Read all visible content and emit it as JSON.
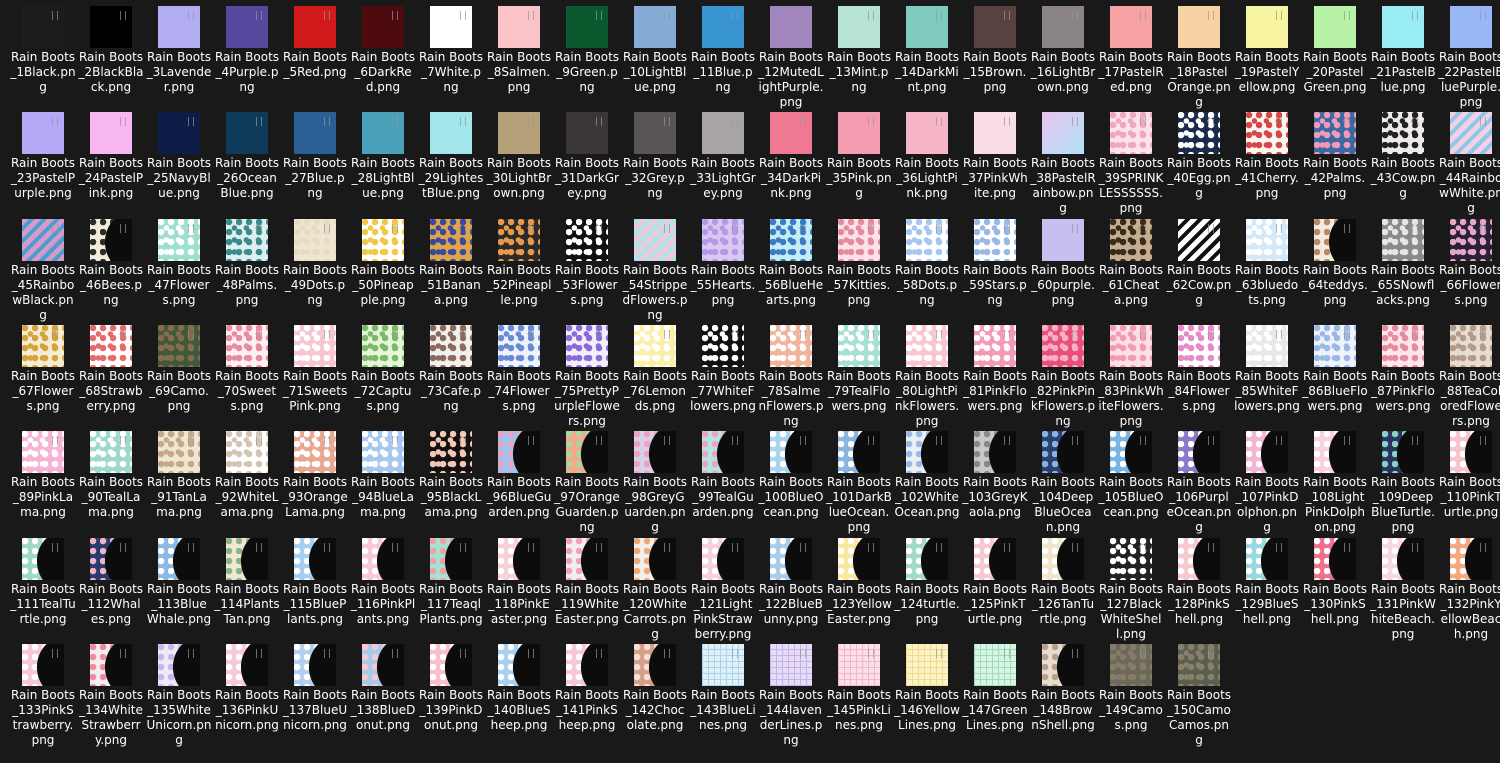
{
  "files": [
    {
      "name": "Rain Boots_1Black.png",
      "color": "#1c1c1c",
      "pattern": "solid"
    },
    {
      "name": "Rain Boots_2BlackBlack.png",
      "color": "#000000",
      "pattern": "solid"
    },
    {
      "name": "Rain Boots_3Lavender.png",
      "color": "#b3aef2",
      "pattern": "solid"
    },
    {
      "name": "Rain Boots_4Purple.png",
      "color": "#55499e",
      "pattern": "solid"
    },
    {
      "name": "Rain Boots_5Red.png",
      "color": "#d11a1a",
      "pattern": "solid"
    },
    {
      "name": "Rain Boots_6DarkRed.png",
      "color": "#4d0b10",
      "pattern": "solid"
    },
    {
      "name": "Rain Boots_7White.png",
      "color": "#ffffff",
      "pattern": "solid"
    },
    {
      "name": "Rain Boots_8Salmen.png",
      "color": "#f9c3c8",
      "pattern": "solid"
    },
    {
      "name": "Rain Boots_9Green.png",
      "color": "#0b5a2f",
      "pattern": "solid"
    },
    {
      "name": "Rain Boots_10LightBlue.png",
      "color": "#86abd4",
      "pattern": "solid"
    },
    {
      "name": "Rain Boots_11Blue.png",
      "color": "#3895d1",
      "pattern": "solid"
    },
    {
      "name": "Rain Boots_12MutedLightPurple.png",
      "color": "#a187be",
      "pattern": "solid"
    },
    {
      "name": "Rain Boots_13Mint.png",
      "color": "#b6e3d4",
      "pattern": "solid"
    },
    {
      "name": "Rain Boots_14DarkMint.png",
      "color": "#7ecabd",
      "pattern": "solid"
    },
    {
      "name": "Rain Boots_15Brown.png",
      "color": "#58413e",
      "pattern": "solid"
    },
    {
      "name": "Rain Boots_16LightBrown.png",
      "color": "#8a8486",
      "pattern": "solid"
    },
    {
      "name": "Rain Boots_17PastelRed.png",
      "color": "#f7a2a2",
      "pattern": "solid"
    },
    {
      "name": "Rain Boots_18PastelOrange.png",
      "color": "#f7d2a2",
      "pattern": "solid"
    },
    {
      "name": "Rain Boots_19PastelYellow.png",
      "color": "#f7f4a2",
      "pattern": "solid"
    },
    {
      "name": "Rain Boots_20PastelGreen.png",
      "color": "#b8f2a6",
      "pattern": "solid"
    },
    {
      "name": "Rain Boots_21PastelBlue.png",
      "color": "#99ebf5",
      "pattern": "solid"
    },
    {
      "name": "Rain Boots_22PastelBluePurple.png",
      "color": "#99b6f5",
      "pattern": "solid"
    },
    {
      "name": "Rain Boots_23PastelPurple.png",
      "color": "#b6a9f7",
      "pattern": "solid"
    },
    {
      "name": "Rain Boots_24PastelPink.png",
      "color": "#f7b6f2",
      "pattern": "solid"
    },
    {
      "name": "Rain Boots_25NavyBlue.png",
      "color": "#0e1d48",
      "pattern": "solid"
    },
    {
      "name": "Rain Boots_26OceanBlue.png",
      "color": "#0f3b5b",
      "pattern": "solid"
    },
    {
      "name": "Rain Boots_27Blue.png",
      "color": "#2a5f93",
      "pattern": "solid"
    },
    {
      "name": "Rain Boots_28LightBlue.png",
      "color": "#49a0b8",
      "pattern": "solid"
    },
    {
      "name": "Rain Boots_29LightestBlue.png",
      "color": "#a2e5ea",
      "pattern": "solid"
    },
    {
      "name": "Rain Boots_30LightBrown.png",
      "color": "#b5a07a",
      "pattern": "solid"
    },
    {
      "name": "Rain Boots_31DarkGrey.png",
      "color": "#3b3636",
      "pattern": "solid"
    },
    {
      "name": "Rain Boots_32Grey.png",
      "color": "#5a5555",
      "pattern": "solid"
    },
    {
      "name": "Rain Boots_33LightGrey.png",
      "color": "#aaa5a5",
      "pattern": "solid"
    },
    {
      "name": "Rain Boots_34DarkPink.png",
      "color": "#ef7993",
      "pattern": "solid"
    },
    {
      "name": "Rain Boots_35Pink.png",
      "color": "#f59db0",
      "pattern": "solid"
    },
    {
      "name": "Rain Boots_36LightPink.png",
      "color": "#f7b6c8",
      "pattern": "solid"
    },
    {
      "name": "Rain Boots_37PinkWhite.png",
      "color": "#f9dde4",
      "pattern": "solid"
    },
    {
      "name": "Rain Boots_38PastelRainbow.png",
      "color": "#e8c3f0",
      "accent": "#b2e3f5",
      "pattern": "mix"
    },
    {
      "name": "Rain Boots_39SPRINKLESSSSSS.png",
      "color": "#fbe3ea",
      "accent": "#f0a6c0",
      "pattern": "dots"
    },
    {
      "name": "Rain Boots_40Egg.png",
      "color": "#1b2a4a",
      "accent": "#ffffff",
      "pattern": "dots"
    },
    {
      "name": "Rain Boots_41Cherry.png",
      "color": "#fbf6f0",
      "accent": "#d64848",
      "pattern": "dots"
    },
    {
      "name": "Rain Boots_42Palms.png",
      "color": "#3c6aa0",
      "accent": "#f29ab8",
      "pattern": "dots"
    },
    {
      "name": "Rain Boots_43Cow.png",
      "color": "#efeaea",
      "accent": "#222222",
      "pattern": "dots"
    },
    {
      "name": "Rain Boots_44RainbowWhite.png",
      "color": "#f2d0e6",
      "accent": "#8ec8e6",
      "pattern": "stripes"
    },
    {
      "name": "Rain Boots_45RainbowBlack.png",
      "color": "#d69bc6",
      "accent": "#4b9cd3",
      "pattern": "stripes"
    },
    {
      "name": "Rain Boots_46Bees.png",
      "color": "#f2ecd8",
      "accent": "#2c2c2c",
      "pattern": "silhouette"
    },
    {
      "name": "Rain Boots_47Flowers.png",
      "color": "#9ee0d0",
      "accent": "#ffffff",
      "pattern": "dots"
    },
    {
      "name": "Rain Boots_48Palms.png",
      "color": "#dfeeee",
      "accent": "#3a8c8c",
      "pattern": "dots"
    },
    {
      "name": "Rain Boots_49Dots.png",
      "color": "#efe6d2",
      "accent": "#e6dcc4",
      "pattern": "dots"
    },
    {
      "name": "Rain Boots_50Pineapple.png",
      "color": "#ffffff",
      "accent": "#f0c846",
      "pattern": "dots"
    },
    {
      "name": "Rain Boots_51Banana.png",
      "color": "#e0a54a",
      "accent": "#3a4a9a",
      "pattern": "dots"
    },
    {
      "name": "Rain Boots_52Pineaplle.png",
      "color": "#2a2a2a",
      "accent": "#e89a4a",
      "pattern": "dots"
    },
    {
      "name": "Rain Boots_53Flowers.png",
      "color": "#111111",
      "accent": "#ffffff",
      "pattern": "dots"
    },
    {
      "name": "Rain Boots_54StrippedFlowers.png",
      "color": "#b4e0ea",
      "accent": "#f4c8d8",
      "pattern": "stripes"
    },
    {
      "name": "Rain Boots_55Hearts.png",
      "color": "#d9c8f2",
      "accent": "#b49ae6",
      "pattern": "dots"
    },
    {
      "name": "Rain Boots_56BlueHearts.png",
      "color": "#c4eef4",
      "accent": "#3a7ac8",
      "pattern": "dots"
    },
    {
      "name": "Rain Boots_57Kitties.png",
      "color": "#fde2e8",
      "accent": "#e68aa0",
      "pattern": "dots"
    },
    {
      "name": "Rain Boots_58Dots.png",
      "color": "#ffffff",
      "accent": "#a6c8f0",
      "pattern": "dots"
    },
    {
      "name": "Rain Boots_59Stars.png",
      "color": "#ffffff",
      "accent": "#9ab8e6",
      "pattern": "dots"
    },
    {
      "name": "Rain Boots_60purple.png",
      "color": "#c9bef0",
      "pattern": "solid"
    },
    {
      "name": "Rain Boots_61Cheata.png",
      "color": "#c4ad90",
      "accent": "#3a2a1a",
      "pattern": "dots"
    },
    {
      "name": "Rain Boots_62Cow.png",
      "color": "#ffffff",
      "accent": "#111111",
      "pattern": "stripes"
    },
    {
      "name": "Rain Boots_63bluedots.png",
      "color": "#d4e8f8",
      "accent": "#ffffff",
      "pattern": "dots"
    },
    {
      "name": "Rain Boots_64teddys.png",
      "color": "#f6eadc",
      "accent": "#b48a6a",
      "pattern": "silhouette"
    },
    {
      "name": "Rain Boots_65SNowflacks.png",
      "color": "#8a8a8a",
      "accent": "#e6e6e6",
      "pattern": "dots"
    },
    {
      "name": "Rain Boots_66Flowers.png",
      "color": "#2a2038",
      "accent": "#e6a6c8",
      "pattern": "dots"
    },
    {
      "name": "Rain Boots_67Flowers.png",
      "color": "#f4ecd4",
      "accent": "#d4a43a",
      "pattern": "dots"
    },
    {
      "name": "Rain Boots_68Strawberry.png",
      "color": "#ffffff",
      "accent": "#e66a6a",
      "pattern": "dots"
    },
    {
      "name": "Rain Boots_69Camo.png",
      "color": "#3e5a3e",
      "accent": "#8a6a4a",
      "pattern": "dots"
    },
    {
      "name": "Rain Boots_70Sweets.png",
      "color": "#fdf0f2",
      "accent": "#e88aa0",
      "pattern": "dots"
    },
    {
      "name": "Rain Boots_71SweetsPink.png",
      "color": "#f7c6d0",
      "accent": "#ffffff",
      "pattern": "dots"
    },
    {
      "name": "Rain Boots_72Captus.png",
      "color": "#e6f4d8",
      "accent": "#7ab86a",
      "pattern": "dots"
    },
    {
      "name": "Rain Boots_73Cafe.png",
      "color": "#f2f0ee",
      "accent": "#8a6a5a",
      "pattern": "dots"
    },
    {
      "name": "Rain Boots_74Flowers.png",
      "color": "#eef2fa",
      "accent": "#6a8ad8",
      "pattern": "dots"
    },
    {
      "name": "Rain Boots_75PrettyPurpleFlowers.png",
      "color": "#f2eefa",
      "accent": "#8a6ad8",
      "pattern": "dots"
    },
    {
      "name": "Rain Boots_76Lemonds.png",
      "color": "#faf0a8",
      "accent": "#ffffff",
      "pattern": "dots"
    },
    {
      "name": "Rain Boots_77WhiteFlowers.png",
      "color": "#111111",
      "accent": "#ffffff",
      "pattern": "dots"
    },
    {
      "name": "Rain Boots_78SalmenFlowers.png",
      "color": "#f0b49a",
      "accent": "#ffffff",
      "pattern": "dots"
    },
    {
      "name": "Rain Boots_79TealFlowers.png",
      "color": "#a6e0d4",
      "accent": "#ffffff",
      "pattern": "dots"
    },
    {
      "name": "Rain Boots_80LightPinkFlowers.png",
      "color": "#f9c6d0",
      "accent": "#ffffff",
      "pattern": "dots"
    },
    {
      "name": "Rain Boots_81PinkFlowers.png",
      "color": "#f49ab4",
      "accent": "#ffffff",
      "pattern": "dots"
    },
    {
      "name": "Rain Boots_82PinkPinkFlowers.png",
      "color": "#e8507a",
      "accent": "#f8b0c4",
      "pattern": "dots"
    },
    {
      "name": "Rain Boots_83PinkWhiteFlowers.png",
      "color": "#fbe0e6",
      "accent": "#f49ab4",
      "pattern": "dots"
    },
    {
      "name": "Rain Boots_84Flowers.png",
      "color": "#ffffff",
      "accent": "#e68ac8",
      "pattern": "dots"
    },
    {
      "name": "Rain Boots_85WhiteFlowers.png",
      "color": "#e8e8ea",
      "accent": "#ffffff",
      "pattern": "dots"
    },
    {
      "name": "Rain Boots_86BlueFlowers.png",
      "color": "#eef2fa",
      "accent": "#9ab8e6",
      "pattern": "dots"
    },
    {
      "name": "Rain Boots_87PinkFlowers.png",
      "color": "#fbe6ea",
      "accent": "#e68aa0",
      "pattern": "dots"
    },
    {
      "name": "Rain Boots_88TeaColoredFlowers.png",
      "color": "#e6dcd0",
      "accent": "#b49a8a",
      "pattern": "dots"
    },
    {
      "name": "Rain Boots_89PinkLama.png",
      "color": "#f6b4d4",
      "accent": "#ffffff",
      "pattern": "dots"
    },
    {
      "name": "Rain Boots_90TealLama.png",
      "color": "#9ed8cc",
      "accent": "#ffffff",
      "pattern": "dots"
    },
    {
      "name": "Rain Boots_91TanLama.png",
      "color": "#f0e6d4",
      "accent": "#c4a88a",
      "pattern": "dots"
    },
    {
      "name": "Rain Boots_92WhiteLama.png",
      "color": "#ffffff",
      "accent": "#d4c4b4",
      "pattern": "dots"
    },
    {
      "name": "Rain Boots_93OrangeLama.png",
      "color": "#e8a890",
      "accent": "#ffffff",
      "pattern": "dots"
    },
    {
      "name": "Rain Boots_94BlueLama.png",
      "color": "#a6c8f0",
      "accent": "#ffffff",
      "pattern": "dots"
    },
    {
      "name": "Rain Boots_95BlackLama.png",
      "color": "#111111",
      "accent": "#f4c8b4",
      "pattern": "dots"
    },
    {
      "name": "Rain Boots_96BlueGuarden.png",
      "color": "#9cc4ec",
      "accent": "#f0a0c0",
      "pattern": "silhouette"
    },
    {
      "name": "Rain Boots_97OrangeGuarden.png",
      "color": "#f4a88c",
      "accent": "#a6d8a6",
      "pattern": "silhouette"
    },
    {
      "name": "Rain Boots_98GreyGuarden.png",
      "color": "#d8d0e6",
      "accent": "#f0a0c0",
      "pattern": "silhouette"
    },
    {
      "name": "Rain Boots_99TealGuarden.png",
      "color": "#b4e4e0",
      "accent": "#f0a0c0",
      "pattern": "silhouette"
    },
    {
      "name": "Rain Boots_100BlueOcean.png",
      "color": "#a8d4f0",
      "accent": "#ffffff",
      "pattern": "silhouette"
    },
    {
      "name": "Rain Boots_101DarkBlueOcean.png",
      "color": "#8ab4e0",
      "accent": "#ffffff",
      "pattern": "silhouette"
    },
    {
      "name": "Rain Boots_102WhiteOcean.png",
      "color": "#e8f0f4",
      "accent": "#9ab8e6",
      "pattern": "silhouette"
    },
    {
      "name": "Rain Boots_103GreyKaola.png",
      "color": "#c8c8cc",
      "accent": "#888888",
      "pattern": "silhouette"
    },
    {
      "name": "Rain Boots_104DeepBlueOcean.png",
      "color": "#2a4070",
      "accent": "#8ab4e0",
      "pattern": "silhouette"
    },
    {
      "name": "Rain Boots_105BlueOcean.png",
      "color": "#78b4e4",
      "accent": "#ffffff",
      "pattern": "silhouette"
    },
    {
      "name": "Rain Boots_106PurpleOcean.png",
      "color": "#8c78c8",
      "accent": "#ffffff",
      "pattern": "silhouette"
    },
    {
      "name": "Rain Boots_107PinkDolphon.png",
      "color": "#f4b4d4",
      "accent": "#ffffff",
      "pattern": "silhouette"
    },
    {
      "name": "Rain Boots_108LightPinkDolphon.png",
      "color": "#f8d0e0",
      "accent": "#ffffff",
      "pattern": "silhouette"
    },
    {
      "name": "Rain Boots_109DeepBlueTurtle.png",
      "color": "#2a3460",
      "accent": "#8ad4c4",
      "pattern": "silhouette"
    },
    {
      "name": "Rain Boots_110PinkTurtle.png",
      "color": "#f6c4cc",
      "accent": "#ffffff",
      "pattern": "silhouette"
    },
    {
      "name": "Rain Boots_111TealTurtle.png",
      "color": "#9ed8c8",
      "accent": "#ffffff",
      "pattern": "silhouette"
    },
    {
      "name": "Rain Boots_112Whales.png",
      "color": "#2a3a6a",
      "accent": "#f0b4c8",
      "pattern": "silhouette"
    },
    {
      "name": "Rain Boots_113BlueWhale.png",
      "color": "#8cb8e4",
      "accent": "#ffffff",
      "pattern": "silhouette"
    },
    {
      "name": "Rain Boots_114PlantsTan.png",
      "color": "#f0e8d4",
      "accent": "#8ab48a",
      "pattern": "silhouette"
    },
    {
      "name": "Rain Boots_115BluePlants.png",
      "color": "#a6cef0",
      "accent": "#ffffff",
      "pattern": "silhouette"
    },
    {
      "name": "Rain Boots_116PinkPlants.png",
      "color": "#f8c8d4",
      "accent": "#ffffff",
      "pattern": "silhouette"
    },
    {
      "name": "Rain Boots_117TeaqlPlants.png",
      "color": "#a8e0d4",
      "accent": "#f0a0a0",
      "pattern": "silhouette"
    },
    {
      "name": "Rain Boots_118PinkEaster.png",
      "color": "#f8d0d8",
      "accent": "#ffffff",
      "pattern": "silhouette"
    },
    {
      "name": "Rain Boots_119WhiteEaster.png",
      "color": "#f2eef0",
      "accent": "#f0a0c0",
      "pattern": "silhouette"
    },
    {
      "name": "Rain Boots_120WhiteCarrots.png",
      "color": "#f2eeec",
      "accent": "#f0a878",
      "pattern": "silhouette"
    },
    {
      "name": "Rain Boots_121LightPinkStrawberry.png",
      "color": "#f8d0dc",
      "accent": "#ffffff",
      "pattern": "silhouette"
    },
    {
      "name": "Rain Boots_122BlueBunny.png",
      "color": "#a8ccec",
      "accent": "#ffffff",
      "pattern": "silhouette"
    },
    {
      "name": "Rain Boots_123YellowEaster.png",
      "color": "#f8e8a0",
      "accent": "#ffffff",
      "pattern": "silhouette"
    },
    {
      "name": "Rain Boots_124turtle.png",
      "color": "#a4d8c8",
      "accent": "#ffffff",
      "pattern": "silhouette"
    },
    {
      "name": "Rain Boots_125PinkTurtle.png",
      "color": "#f8c8d0",
      "accent": "#ffffff",
      "pattern": "silhouette"
    },
    {
      "name": "Rain Boots_126TanTurtle.png",
      "color": "#f0e4cc",
      "accent": "#ffffff",
      "pattern": "silhouette"
    },
    {
      "name": "Rain Boots_127BlackWhiteShell.png",
      "color": "#222222",
      "accent": "#ffffff",
      "pattern": "dots"
    },
    {
      "name": "Rain Boots_128PinkShell.png",
      "color": "#f8c8d0",
      "accent": "#ffffff",
      "pattern": "silhouette"
    },
    {
      "name": "Rain Boots_129BlueShell.png",
      "color": "#9ad8e0",
      "accent": "#ffffff",
      "pattern": "silhouette"
    },
    {
      "name": "Rain Boots_130PinkShell.png",
      "color": "#f0708c",
      "accent": "#ffffff",
      "pattern": "silhouette"
    },
    {
      "name": "Rain Boots_131PinkWhiteBeach.png",
      "color": "#f8d8e0",
      "accent": "#ffffff",
      "pattern": "silhouette"
    },
    {
      "name": "Rain Boots_132PinkYellowBeach.png",
      "color": "#f4a880",
      "accent": "#ffffff",
      "pattern": "silhouette"
    },
    {
      "name": "Rain Boots_133PinkStrawberry.png",
      "color": "#f8c8d4",
      "accent": "#ffffff",
      "pattern": "silhouette"
    },
    {
      "name": "Rain Boots_134WhiteStrawberry.png",
      "color": "#f4eef0",
      "accent": "#f08aa0",
      "pattern": "silhouette"
    },
    {
      "name": "Rain Boots_135WhiteUnicorn.png",
      "color": "#eceaf4",
      "accent": "#c8b4f0",
      "pattern": "silhouette"
    },
    {
      "name": "Rain Boots_136PinkUnicorn.png",
      "color": "#f8c8dc",
      "accent": "#ffffff",
      "pattern": "silhouette"
    },
    {
      "name": "Rain Boots_137BlueUnicorn.png",
      "color": "#b4d0f0",
      "accent": "#ffffff",
      "pattern": "silhouette"
    },
    {
      "name": "Rain Boots_138BlueDonut.png",
      "color": "#a8cce8",
      "accent": "#f8c8d4",
      "pattern": "silhouette"
    },
    {
      "name": "Rain Boots_139PinkDonut.png",
      "color": "#f8c0cc",
      "accent": "#ffffff",
      "pattern": "silhouette"
    },
    {
      "name": "Rain Boots_140BlueSheep.png",
      "color": "#a8d0f0",
      "accent": "#ffffff",
      "pattern": "silhouette"
    },
    {
      "name": "Rain Boots_141PinkSheep.png",
      "color": "#f8c8d4",
      "accent": "#ffffff",
      "pattern": "silhouette"
    },
    {
      "name": "Rain Boots_142Chocolate.png",
      "color": "#d4a08c",
      "accent": "#f8e0d4",
      "pattern": "silhouette"
    },
    {
      "name": "Rain Boots_143BlueLines.png",
      "color": "#dff0f8",
      "accent": "#a8d4ec",
      "pattern": "grid"
    },
    {
      "name": "Rain Boots_144lavenderLines.png",
      "color": "#e6dcf4",
      "accent": "#c4b0ec",
      "pattern": "grid"
    },
    {
      "name": "Rain Boots_145PinkLines.png",
      "color": "#fbe0e8",
      "accent": "#f4b4c8",
      "pattern": "grid"
    },
    {
      "name": "Rain Boots_146YellowLines.png",
      "color": "#fbf2c8",
      "accent": "#f0dc88",
      "pattern": "grid"
    },
    {
      "name": "Rain Boots_147GreenLines.png",
      "color": "#d8f4e4",
      "accent": "#a0dcbc",
      "pattern": "grid"
    },
    {
      "name": "Rain Boots_148BrownShell.png",
      "color": "#e8dccc",
      "accent": "#b4a08c",
      "pattern": "silhouette"
    },
    {
      "name": "Rain Boots_149Camos.png",
      "color": "#6a6a5a",
      "accent": "#8a7a68",
      "pattern": "dots"
    },
    {
      "name": "Rain Boots_150CamoCamos.png",
      "color": "#5a6050",
      "accent": "#8a806a",
      "pattern": "dots"
    }
  ]
}
